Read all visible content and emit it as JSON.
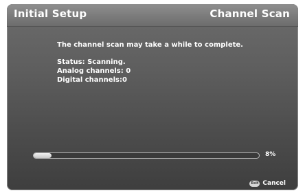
{
  "header": {
    "title": "Initial Setup",
    "section": "Channel Scan"
  },
  "message": "The channel scan may take a while to complete.",
  "status": {
    "status_line": "Status: Scanning.",
    "analog_line": "Analog channels: 0",
    "digital_line": "Digital channels:0"
  },
  "progress": {
    "value": 0.08,
    "label": "8%"
  },
  "footer": {
    "exit_key_label": "Exit",
    "cancel_label": "Cancel"
  },
  "colors": {
    "accent": "#ffffff",
    "background": "#5e5e5e"
  }
}
